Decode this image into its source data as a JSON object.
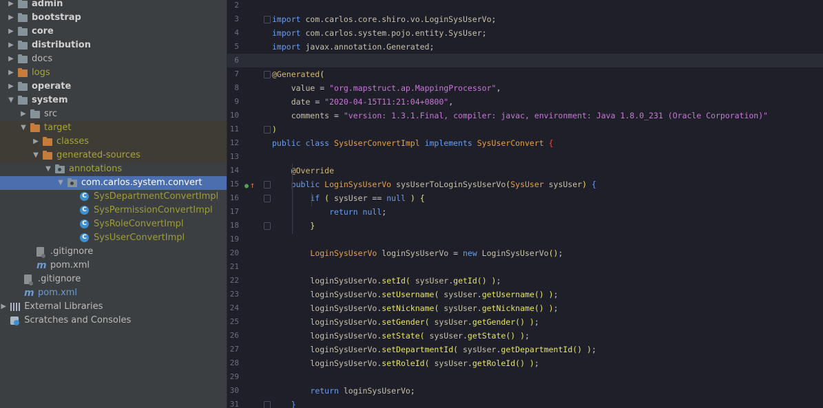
{
  "tree": {
    "rows": [
      {
        "label": "admin",
        "indent": 0,
        "arrow": "collapsed",
        "icon": "folder-grey",
        "style": "bold"
      },
      {
        "label": "bootstrap",
        "indent": 0,
        "arrow": "collapsed",
        "icon": "folder-grey",
        "style": "bold"
      },
      {
        "label": "core",
        "indent": 0,
        "arrow": "collapsed",
        "icon": "folder-grey",
        "style": "bold"
      },
      {
        "label": "distribution",
        "indent": 0,
        "arrow": "collapsed",
        "icon": "folder-grey",
        "style": "bold"
      },
      {
        "label": "docs",
        "indent": 0,
        "arrow": "collapsed",
        "icon": "folder-grey",
        "style": "normal"
      },
      {
        "label": "logs",
        "indent": 0,
        "arrow": "collapsed",
        "icon": "folder-orange",
        "style": "olive"
      },
      {
        "label": "operate",
        "indent": 0,
        "arrow": "collapsed",
        "icon": "folder-grey",
        "style": "bold"
      },
      {
        "label": "system",
        "indent": 0,
        "arrow": "expanded",
        "icon": "folder-grey",
        "style": "bold"
      },
      {
        "label": "src",
        "indent": 1,
        "arrow": "collapsed",
        "icon": "folder-grey",
        "style": "normal"
      },
      {
        "label": "target",
        "indent": 1,
        "arrow": "expanded",
        "icon": "folder-orange",
        "style": "olive",
        "excluded": true
      },
      {
        "label": "classes",
        "indent": 2,
        "arrow": "collapsed",
        "icon": "folder-orange",
        "style": "olive",
        "excluded": true
      },
      {
        "label": "generated-sources",
        "indent": 2,
        "arrow": "expanded",
        "icon": "folder-orange",
        "style": "olive",
        "excluded": true
      },
      {
        "label": "annotations",
        "indent": 3,
        "arrow": "expanded",
        "icon": "folder-pkg",
        "style": "olive"
      },
      {
        "label": "com.carlos.system.convert",
        "indent": 4,
        "arrow": "expanded",
        "icon": "folder-pkg",
        "style": "white",
        "selected": true
      },
      {
        "label": "SysDepartmentConvertImpl",
        "indent": 5,
        "arrow": "none",
        "icon": "class",
        "style": "olive2"
      },
      {
        "label": "SysPermissionConvertImpl",
        "indent": 5,
        "arrow": "none",
        "icon": "class",
        "style": "olive2"
      },
      {
        "label": "SysRoleConvertImpl",
        "indent": 5,
        "arrow": "none",
        "icon": "class",
        "style": "olive2"
      },
      {
        "label": "SysUserConvertImpl",
        "indent": 5,
        "arrow": "none",
        "icon": "class",
        "style": "olive2"
      },
      {
        "label": ".gitignore",
        "indent": 1.5,
        "arrow": "none",
        "icon": "gitignore",
        "style": "normal"
      },
      {
        "label": "pom.xml",
        "indent": 1.5,
        "arrow": "none",
        "icon": "maven",
        "style": "normal"
      },
      {
        "label": ".gitignore",
        "indent": 0.5,
        "arrow": "none",
        "icon": "gitignore",
        "style": "normal"
      },
      {
        "label": "pom.xml",
        "indent": 0.5,
        "arrow": "none",
        "icon": "maven",
        "style": "blueish"
      },
      {
        "label": "External Libraries",
        "indent": -0.6,
        "arrow": "collapsed",
        "icon": "libraries",
        "style": "normal"
      },
      {
        "label": "Scratches and Consoles",
        "indent": -0.6,
        "arrow": "none",
        "icon": "scratches",
        "style": "normal"
      }
    ]
  },
  "editor": {
    "current_line": 6,
    "lines": [
      {
        "n": "2",
        "fold": false,
        "tokens": []
      },
      {
        "n": "3",
        "fold": true,
        "tokens": [
          [
            "k",
            "import "
          ],
          [
            "t",
            "com.carlos.core.shiro.vo.LoginSysUserVo"
          ],
          [
            "o",
            ";"
          ]
        ]
      },
      {
        "n": "4",
        "fold": false,
        "tokens": [
          [
            "k",
            "import "
          ],
          [
            "t",
            "com.carlos.system.pojo.entity.SysUser"
          ],
          [
            "o",
            ";"
          ]
        ]
      },
      {
        "n": "5",
        "fold": false,
        "tokens": [
          [
            "k",
            "import "
          ],
          [
            "t",
            "javax.annotation.Generated"
          ],
          [
            "o",
            ";"
          ]
        ]
      },
      {
        "n": "6",
        "fold": false,
        "tokens": []
      },
      {
        "n": "7",
        "fold": true,
        "tokens": [
          [
            "a",
            "@Generated"
          ],
          [
            "y",
            "("
          ]
        ]
      },
      {
        "n": "8",
        "fold": false,
        "tokens": [
          [
            "t",
            "    value "
          ],
          [
            "o",
            "= "
          ],
          [
            "s",
            "\"org.mapstruct.ap.MappingProcessor\""
          ],
          [
            "o",
            ","
          ]
        ]
      },
      {
        "n": "9",
        "fold": false,
        "tokens": [
          [
            "t",
            "    date "
          ],
          [
            "o",
            "= "
          ],
          [
            "s",
            "\"2020-04-15T11:21:04+0800\""
          ],
          [
            "o",
            ","
          ]
        ]
      },
      {
        "n": "10",
        "fold": false,
        "tokens": [
          [
            "t",
            "    comments "
          ],
          [
            "o",
            "= "
          ],
          [
            "s",
            "\"version: 1.3.1.Final, compiler: javac, environment: Java 1.8.0_231 (Oracle Corporation)\""
          ]
        ]
      },
      {
        "n": "11",
        "fold": true,
        "tokens": [
          [
            "y",
            ")"
          ]
        ]
      },
      {
        "n": "12",
        "fold": false,
        "tokens": [
          [
            "k",
            "public class "
          ],
          [
            "sym",
            "SysUserConvertImpl "
          ],
          [
            "k",
            "implements "
          ],
          [
            "sym",
            "SysUserConvert "
          ],
          [
            "r",
            "{"
          ]
        ]
      },
      {
        "n": "13",
        "fold": false,
        "tokens": []
      },
      {
        "n": "14",
        "fold": false,
        "tokens": [
          [
            "t",
            "    "
          ],
          [
            "a",
            "@Override"
          ]
        ]
      },
      {
        "n": "15",
        "fold": true,
        "marker": true,
        "tokens": [
          [
            "t",
            "    "
          ],
          [
            "k",
            "public "
          ],
          [
            "sym",
            "LoginSysUserVo "
          ],
          [
            "t",
            "sysUserToLoginSysUserVo"
          ],
          [
            "y",
            "("
          ],
          [
            "sym",
            "SysUser "
          ],
          [
            "t",
            "sysUser"
          ],
          [
            "y",
            ") "
          ],
          [
            "bl",
            "{"
          ]
        ]
      },
      {
        "n": "16",
        "fold": true,
        "tokens": [
          [
            "t",
            "        "
          ],
          [
            "k",
            "if "
          ],
          [
            "y",
            "( "
          ],
          [
            "t",
            "sysUser "
          ],
          [
            "o",
            "== "
          ],
          [
            "k",
            "null "
          ],
          [
            "y",
            ") "
          ],
          [
            "y",
            "{"
          ]
        ]
      },
      {
        "n": "17",
        "fold": false,
        "tokens": [
          [
            "t",
            "            "
          ],
          [
            "k",
            "return null"
          ],
          [
            "o",
            ";"
          ]
        ]
      },
      {
        "n": "18",
        "fold": true,
        "tokens": [
          [
            "t",
            "        "
          ],
          [
            "y",
            "}"
          ]
        ]
      },
      {
        "n": "19",
        "fold": false,
        "tokens": []
      },
      {
        "n": "20",
        "fold": false,
        "tokens": [
          [
            "t",
            "        "
          ],
          [
            "sym",
            "LoginSysUserVo "
          ],
          [
            "t",
            "loginSysUserVo "
          ],
          [
            "o",
            "= "
          ],
          [
            "k",
            "new "
          ],
          [
            "t",
            "LoginSysUserVo"
          ],
          [
            "y",
            "()"
          ],
          [
            "o",
            ";"
          ]
        ]
      },
      {
        "n": "21",
        "fold": false,
        "tokens": []
      },
      {
        "n": "22",
        "fold": false,
        "tokens": [
          [
            "t",
            "        loginSysUserVo"
          ],
          [
            "o",
            "."
          ],
          [
            "y",
            "setId"
          ],
          [
            "y",
            "( "
          ],
          [
            "t",
            "sysUser"
          ],
          [
            "o",
            "."
          ],
          [
            "y",
            "getId"
          ],
          [
            "y",
            "() )"
          ],
          [
            "o",
            ";"
          ]
        ]
      },
      {
        "n": "23",
        "fold": false,
        "tokens": [
          [
            "t",
            "        loginSysUserVo"
          ],
          [
            "o",
            "."
          ],
          [
            "y",
            "setUsername"
          ],
          [
            "y",
            "( "
          ],
          [
            "t",
            "sysUser"
          ],
          [
            "o",
            "."
          ],
          [
            "y",
            "getUsername"
          ],
          [
            "y",
            "() )"
          ],
          [
            "o",
            ";"
          ]
        ]
      },
      {
        "n": "24",
        "fold": false,
        "tokens": [
          [
            "t",
            "        loginSysUserVo"
          ],
          [
            "o",
            "."
          ],
          [
            "y",
            "setNickname"
          ],
          [
            "y",
            "( "
          ],
          [
            "t",
            "sysUser"
          ],
          [
            "o",
            "."
          ],
          [
            "y",
            "getNickname"
          ],
          [
            "y",
            "() )"
          ],
          [
            "o",
            ";"
          ]
        ]
      },
      {
        "n": "25",
        "fold": false,
        "tokens": [
          [
            "t",
            "        loginSysUserVo"
          ],
          [
            "o",
            "."
          ],
          [
            "y",
            "setGender"
          ],
          [
            "y",
            "( "
          ],
          [
            "t",
            "sysUser"
          ],
          [
            "o",
            "."
          ],
          [
            "y",
            "getGender"
          ],
          [
            "y",
            "() )"
          ],
          [
            "o",
            ";"
          ]
        ]
      },
      {
        "n": "26",
        "fold": false,
        "tokens": [
          [
            "t",
            "        loginSysUserVo"
          ],
          [
            "o",
            "."
          ],
          [
            "y",
            "setState"
          ],
          [
            "y",
            "( "
          ],
          [
            "t",
            "sysUser"
          ],
          [
            "o",
            "."
          ],
          [
            "y",
            "getState"
          ],
          [
            "y",
            "() )"
          ],
          [
            "o",
            ";"
          ]
        ]
      },
      {
        "n": "27",
        "fold": false,
        "tokens": [
          [
            "t",
            "        loginSysUserVo"
          ],
          [
            "o",
            "."
          ],
          [
            "y",
            "setDepartmentId"
          ],
          [
            "y",
            "( "
          ],
          [
            "t",
            "sysUser"
          ],
          [
            "o",
            "."
          ],
          [
            "y",
            "getDepartmentId"
          ],
          [
            "y",
            "() )"
          ],
          [
            "o",
            ";"
          ]
        ]
      },
      {
        "n": "28",
        "fold": false,
        "tokens": [
          [
            "t",
            "        loginSysUserVo"
          ],
          [
            "o",
            "."
          ],
          [
            "y",
            "setRoleId"
          ],
          [
            "y",
            "( "
          ],
          [
            "t",
            "sysUser"
          ],
          [
            "o",
            "."
          ],
          [
            "y",
            "getRoleId"
          ],
          [
            "y",
            "() )"
          ],
          [
            "o",
            ";"
          ]
        ]
      },
      {
        "n": "29",
        "fold": false,
        "tokens": []
      },
      {
        "n": "30",
        "fold": false,
        "tokens": [
          [
            "t",
            "        "
          ],
          [
            "k",
            "return "
          ],
          [
            "t",
            "loginSysUserVo"
          ],
          [
            "o",
            ";"
          ]
        ]
      },
      {
        "n": "31",
        "fold": true,
        "tokens": [
          [
            "t",
            "    "
          ],
          [
            "bl",
            "}"
          ]
        ]
      }
    ]
  }
}
